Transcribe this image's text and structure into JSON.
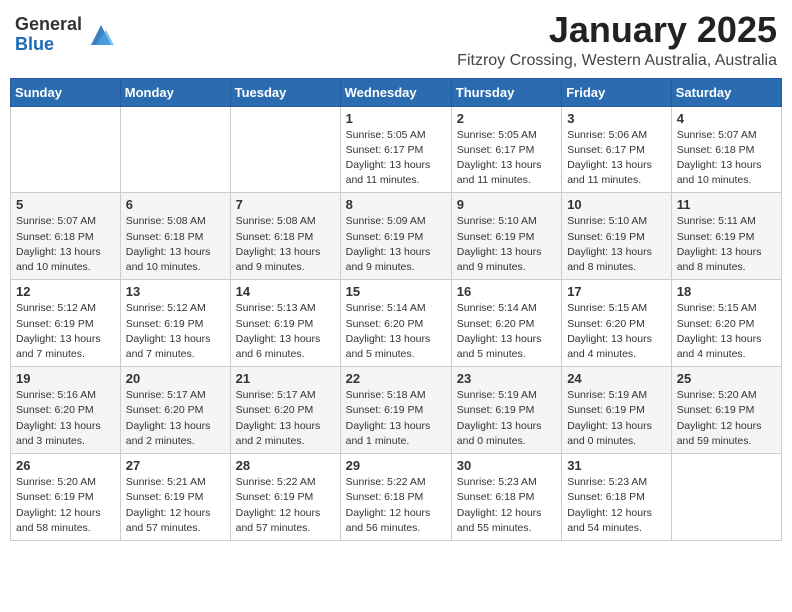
{
  "header": {
    "logo_general": "General",
    "logo_blue": "Blue",
    "month_title": "January 2025",
    "location": "Fitzroy Crossing, Western Australia, Australia"
  },
  "weekdays": [
    "Sunday",
    "Monday",
    "Tuesday",
    "Wednesday",
    "Thursday",
    "Friday",
    "Saturday"
  ],
  "weeks": [
    [
      {
        "day": "",
        "info": ""
      },
      {
        "day": "",
        "info": ""
      },
      {
        "day": "",
        "info": ""
      },
      {
        "day": "1",
        "info": "Sunrise: 5:05 AM\nSunset: 6:17 PM\nDaylight: 13 hours\nand 11 minutes."
      },
      {
        "day": "2",
        "info": "Sunrise: 5:05 AM\nSunset: 6:17 PM\nDaylight: 13 hours\nand 11 minutes."
      },
      {
        "day": "3",
        "info": "Sunrise: 5:06 AM\nSunset: 6:17 PM\nDaylight: 13 hours\nand 11 minutes."
      },
      {
        "day": "4",
        "info": "Sunrise: 5:07 AM\nSunset: 6:18 PM\nDaylight: 13 hours\nand 10 minutes."
      }
    ],
    [
      {
        "day": "5",
        "info": "Sunrise: 5:07 AM\nSunset: 6:18 PM\nDaylight: 13 hours\nand 10 minutes."
      },
      {
        "day": "6",
        "info": "Sunrise: 5:08 AM\nSunset: 6:18 PM\nDaylight: 13 hours\nand 10 minutes."
      },
      {
        "day": "7",
        "info": "Sunrise: 5:08 AM\nSunset: 6:18 PM\nDaylight: 13 hours\nand 9 minutes."
      },
      {
        "day": "8",
        "info": "Sunrise: 5:09 AM\nSunset: 6:19 PM\nDaylight: 13 hours\nand 9 minutes."
      },
      {
        "day": "9",
        "info": "Sunrise: 5:10 AM\nSunset: 6:19 PM\nDaylight: 13 hours\nand 9 minutes."
      },
      {
        "day": "10",
        "info": "Sunrise: 5:10 AM\nSunset: 6:19 PM\nDaylight: 13 hours\nand 8 minutes."
      },
      {
        "day": "11",
        "info": "Sunrise: 5:11 AM\nSunset: 6:19 PM\nDaylight: 13 hours\nand 8 minutes."
      }
    ],
    [
      {
        "day": "12",
        "info": "Sunrise: 5:12 AM\nSunset: 6:19 PM\nDaylight: 13 hours\nand 7 minutes."
      },
      {
        "day": "13",
        "info": "Sunrise: 5:12 AM\nSunset: 6:19 PM\nDaylight: 13 hours\nand 7 minutes."
      },
      {
        "day": "14",
        "info": "Sunrise: 5:13 AM\nSunset: 6:19 PM\nDaylight: 13 hours\nand 6 minutes."
      },
      {
        "day": "15",
        "info": "Sunrise: 5:14 AM\nSunset: 6:20 PM\nDaylight: 13 hours\nand 5 minutes."
      },
      {
        "day": "16",
        "info": "Sunrise: 5:14 AM\nSunset: 6:20 PM\nDaylight: 13 hours\nand 5 minutes."
      },
      {
        "day": "17",
        "info": "Sunrise: 5:15 AM\nSunset: 6:20 PM\nDaylight: 13 hours\nand 4 minutes."
      },
      {
        "day": "18",
        "info": "Sunrise: 5:15 AM\nSunset: 6:20 PM\nDaylight: 13 hours\nand 4 minutes."
      }
    ],
    [
      {
        "day": "19",
        "info": "Sunrise: 5:16 AM\nSunset: 6:20 PM\nDaylight: 13 hours\nand 3 minutes."
      },
      {
        "day": "20",
        "info": "Sunrise: 5:17 AM\nSunset: 6:20 PM\nDaylight: 13 hours\nand 2 minutes."
      },
      {
        "day": "21",
        "info": "Sunrise: 5:17 AM\nSunset: 6:20 PM\nDaylight: 13 hours\nand 2 minutes."
      },
      {
        "day": "22",
        "info": "Sunrise: 5:18 AM\nSunset: 6:19 PM\nDaylight: 13 hours\nand 1 minute."
      },
      {
        "day": "23",
        "info": "Sunrise: 5:19 AM\nSunset: 6:19 PM\nDaylight: 13 hours\nand 0 minutes."
      },
      {
        "day": "24",
        "info": "Sunrise: 5:19 AM\nSunset: 6:19 PM\nDaylight: 13 hours\nand 0 minutes."
      },
      {
        "day": "25",
        "info": "Sunrise: 5:20 AM\nSunset: 6:19 PM\nDaylight: 12 hours\nand 59 minutes."
      }
    ],
    [
      {
        "day": "26",
        "info": "Sunrise: 5:20 AM\nSunset: 6:19 PM\nDaylight: 12 hours\nand 58 minutes."
      },
      {
        "day": "27",
        "info": "Sunrise: 5:21 AM\nSunset: 6:19 PM\nDaylight: 12 hours\nand 57 minutes."
      },
      {
        "day": "28",
        "info": "Sunrise: 5:22 AM\nSunset: 6:19 PM\nDaylight: 12 hours\nand 57 minutes."
      },
      {
        "day": "29",
        "info": "Sunrise: 5:22 AM\nSunset: 6:18 PM\nDaylight: 12 hours\nand 56 minutes."
      },
      {
        "day": "30",
        "info": "Sunrise: 5:23 AM\nSunset: 6:18 PM\nDaylight: 12 hours\nand 55 minutes."
      },
      {
        "day": "31",
        "info": "Sunrise: 5:23 AM\nSunset: 6:18 PM\nDaylight: 12 hours\nand 54 minutes."
      },
      {
        "day": "",
        "info": ""
      }
    ]
  ]
}
